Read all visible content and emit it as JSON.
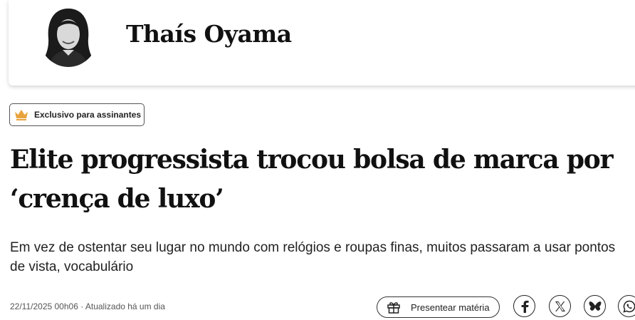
{
  "author": {
    "name": "Thaís Oyama"
  },
  "badge": {
    "label": "Exclusivo para assinantes",
    "icon": "crown-icon",
    "color": "#e8a33d"
  },
  "article": {
    "headline": "Elite progressista trocou bolsa de marca por ‘crença de luxo’",
    "standfirst": "Em vez de ostentar seu lugar no mundo com relógios e roupas finas, muitos passaram a usar pontos de vista, vocabulário",
    "meta": "22/11/2025 00h06 · Atualizado há um dia"
  },
  "actions": {
    "gift_label": "Presentear matéria",
    "share": [
      "facebook-icon",
      "x-icon",
      "bluesky-icon",
      "whatsapp-icon"
    ]
  }
}
